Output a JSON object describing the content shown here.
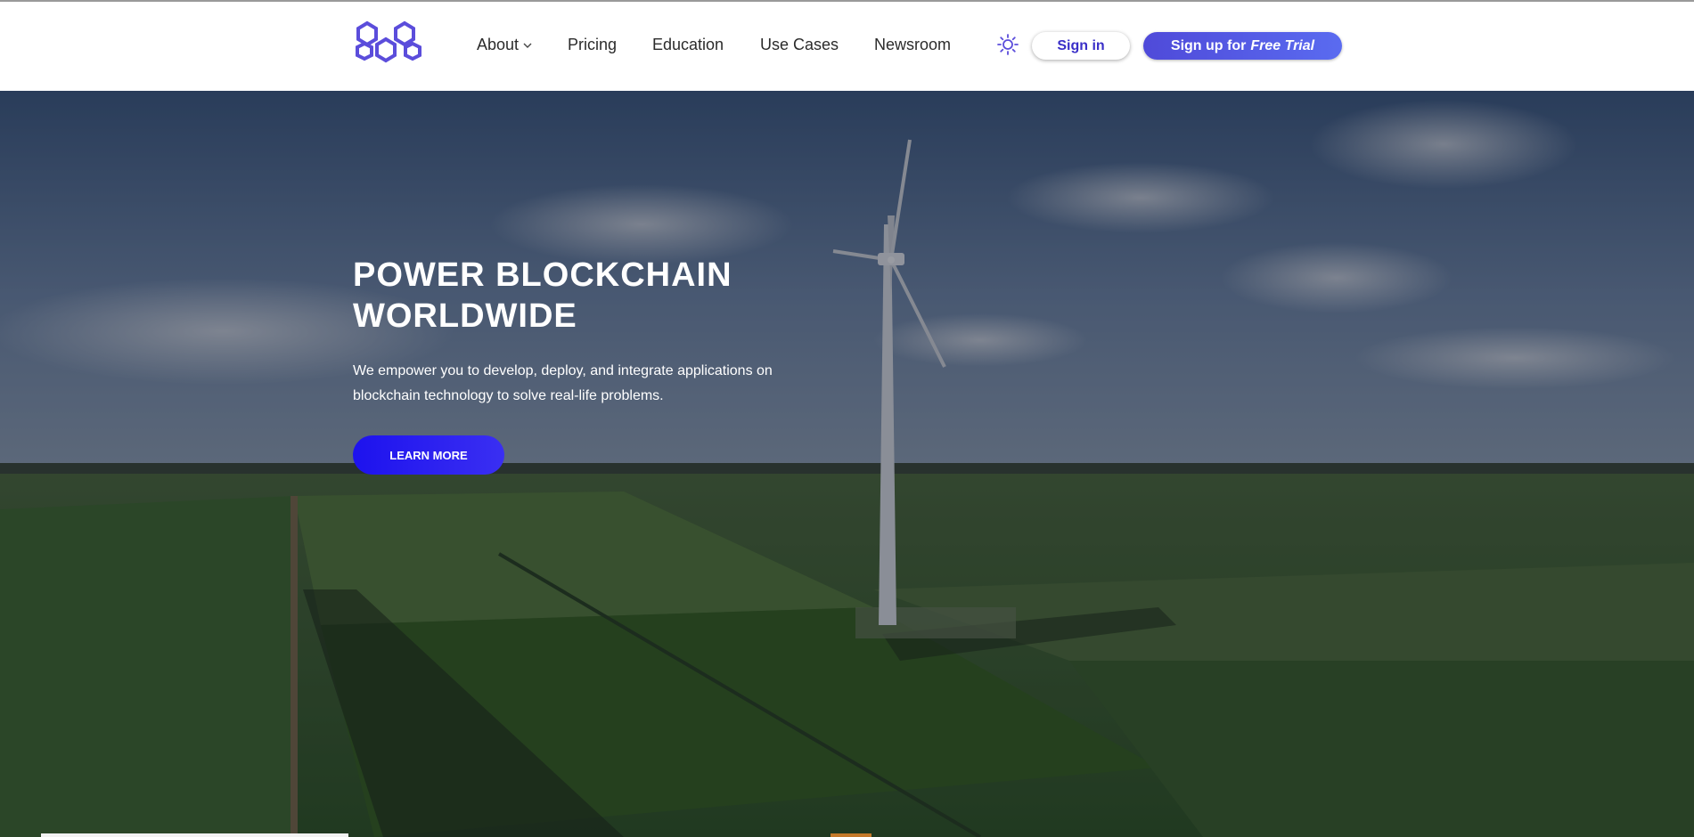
{
  "brand": {
    "logo_icon": "hexagon-cluster-icon",
    "accent": "#5b4ddb"
  },
  "nav": {
    "items": [
      {
        "label": "About",
        "has_dropdown": true
      },
      {
        "label": "Pricing"
      },
      {
        "label": "Education"
      },
      {
        "label": "Use Cases"
      },
      {
        "label": "Newsroom"
      }
    ],
    "theme_icon": "sun-icon",
    "signin_label": "Sign in",
    "signup_label": "Sign up for",
    "signup_emphasis": "Free Trial"
  },
  "hero": {
    "title_line1": "POWER BLOCKCHAIN",
    "title_line2": "WORLDWIDE",
    "description": "We empower you to develop, deploy, and integrate applications on blockchain technology to solve real-life problems.",
    "cta_label": "LEARN MORE",
    "cta_color": "#1d12ee",
    "background": "wind-turbine-farmland-image"
  }
}
